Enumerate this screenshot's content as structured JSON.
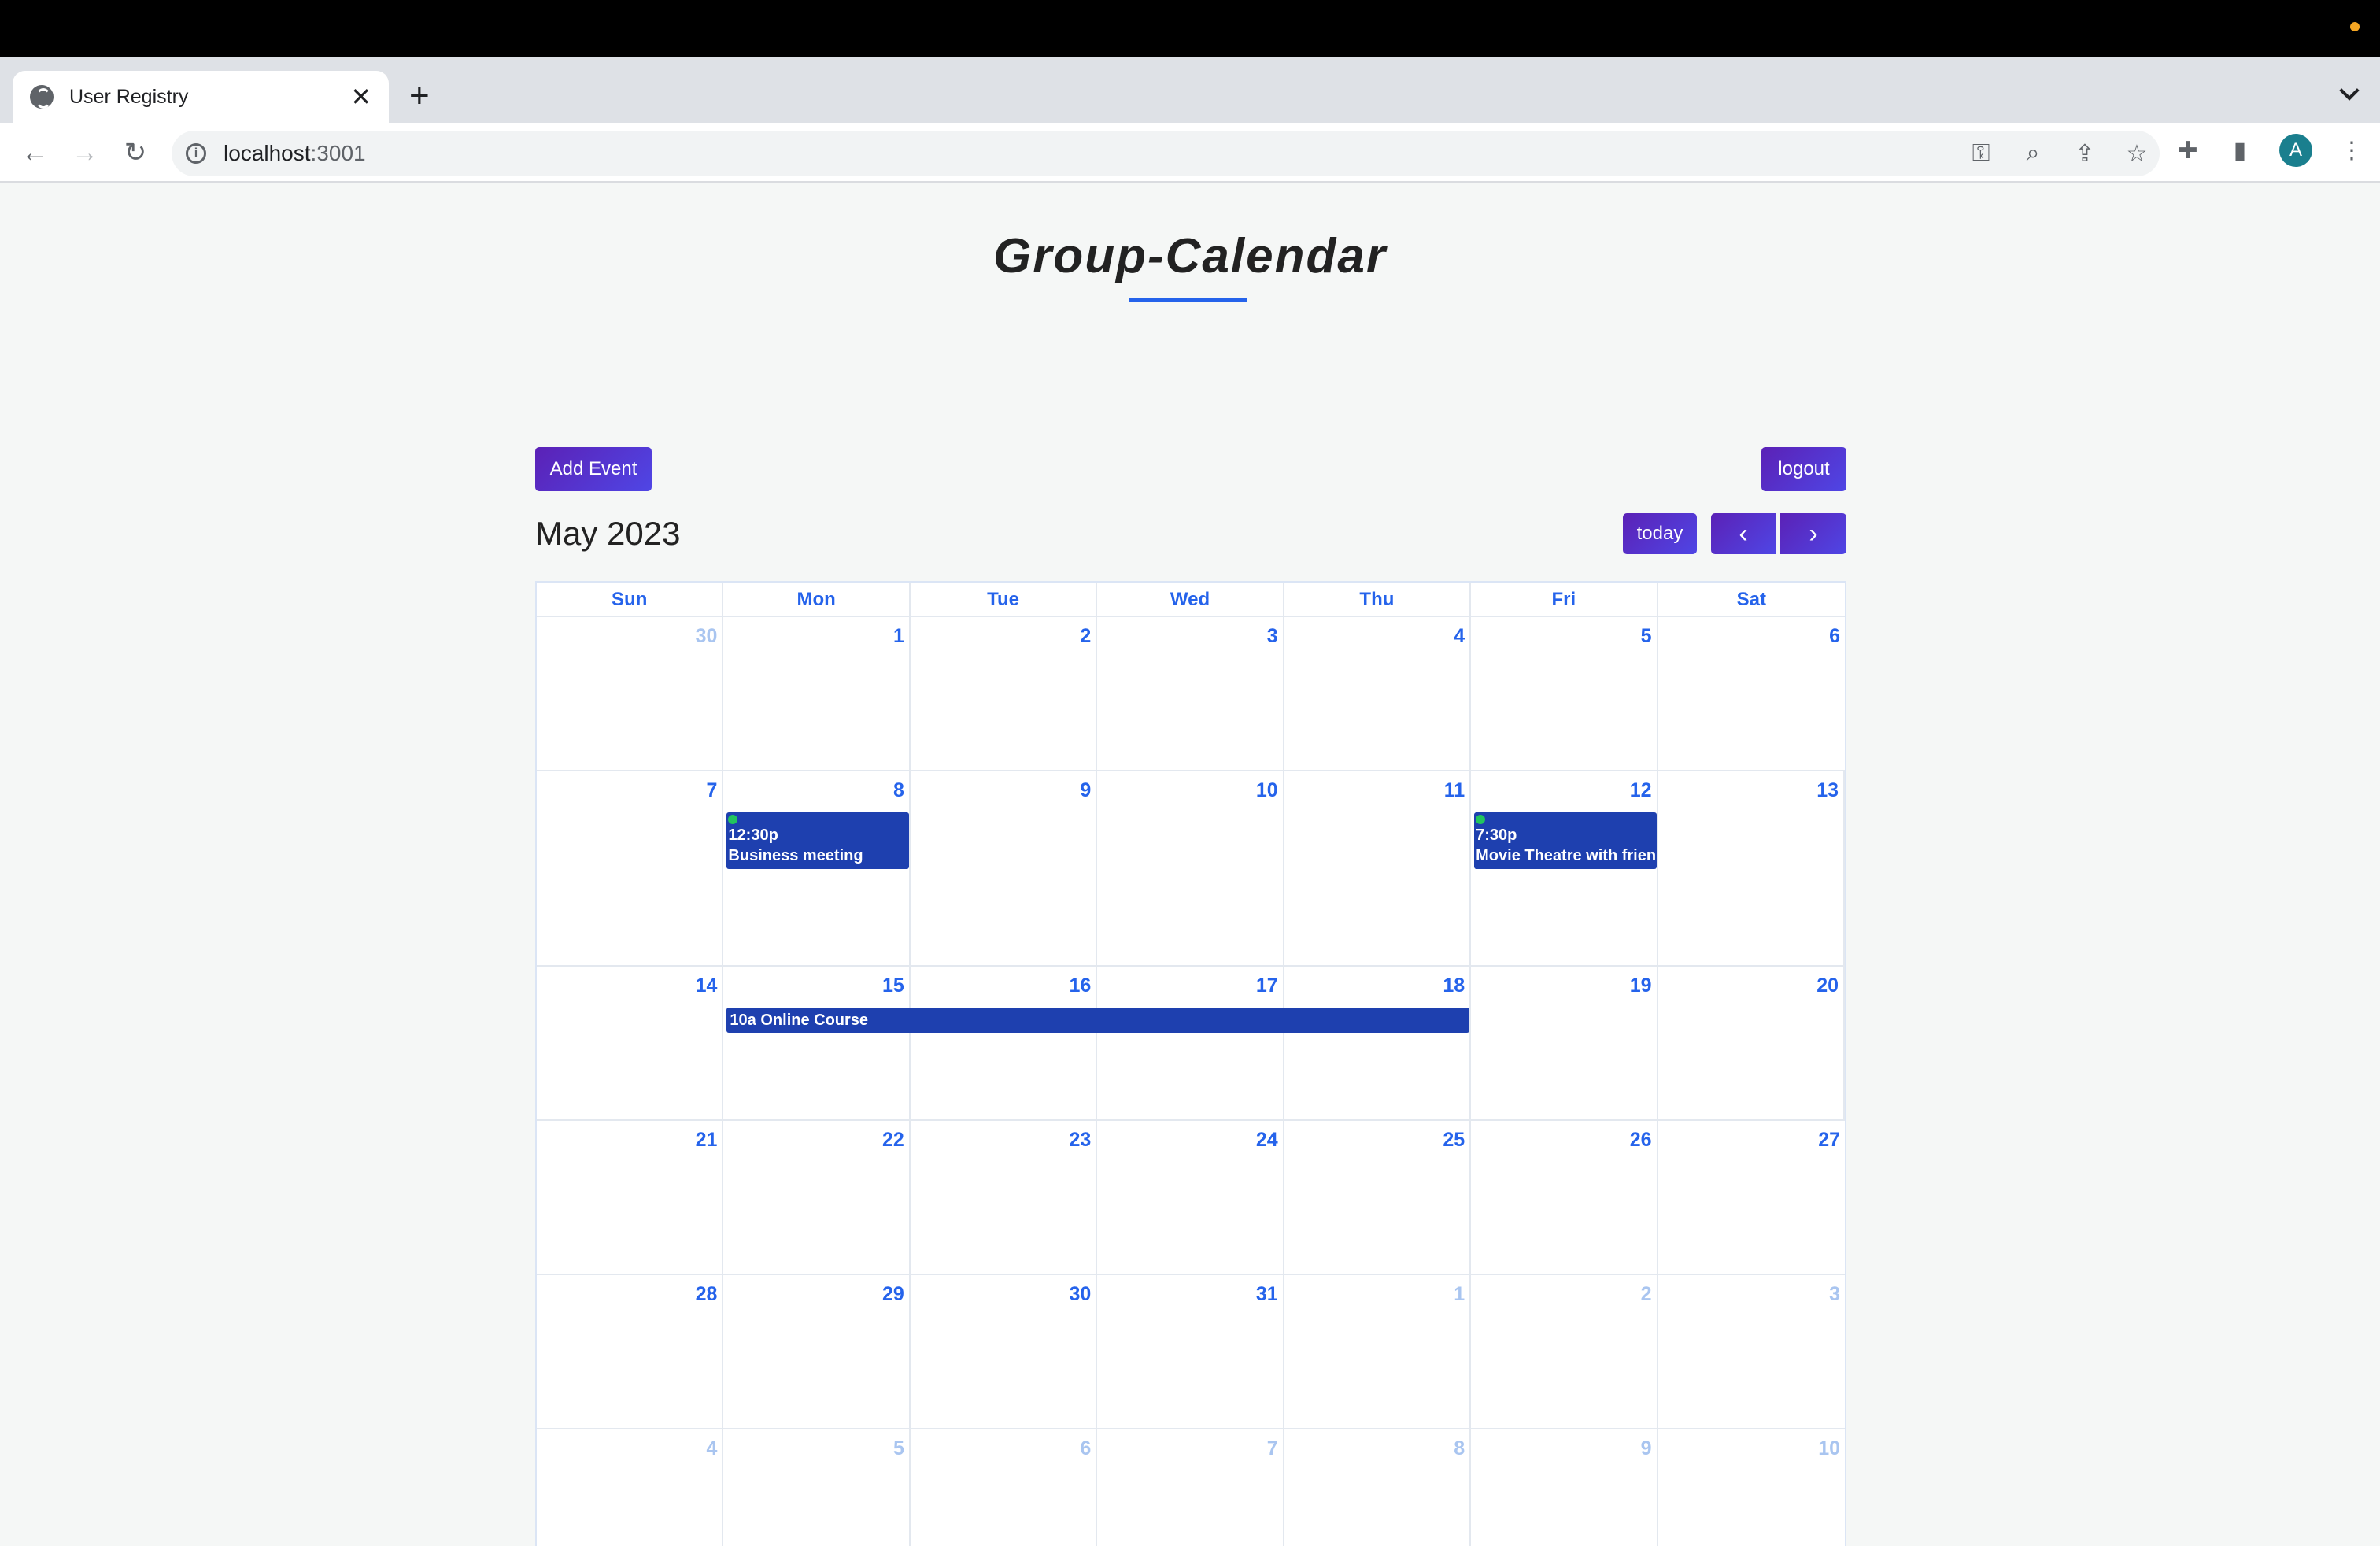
{
  "browser": {
    "tab_title": "User Registry",
    "new_tab": "+",
    "close": "✕",
    "url_host": "localhost",
    "url_port": ":3001",
    "profile_initial": "A"
  },
  "page": {
    "title": "Group-Calendar",
    "add_event_label": "Add Event",
    "logout_label": "logout",
    "today_label": "today",
    "prev_label": "‹",
    "next_label": "›",
    "month_label": "May 2023"
  },
  "calendar": {
    "days_of_week": [
      "Sun",
      "Mon",
      "Tue",
      "Wed",
      "Thu",
      "Fri",
      "Sat"
    ],
    "weeks": [
      [
        {
          "d": "30",
          "o": true
        },
        {
          "d": "1"
        },
        {
          "d": "2"
        },
        {
          "d": "3"
        },
        {
          "d": "4"
        },
        {
          "d": "5"
        },
        {
          "d": "6"
        }
      ],
      [
        {
          "d": "7"
        },
        {
          "d": "8"
        },
        {
          "d": "9"
        },
        {
          "d": "10"
        },
        {
          "d": "11"
        },
        {
          "d": "12"
        },
        {
          "d": "13"
        }
      ],
      [
        {
          "d": "14"
        },
        {
          "d": "15"
        },
        {
          "d": "16"
        },
        {
          "d": "17"
        },
        {
          "d": "18"
        },
        {
          "d": "19"
        },
        {
          "d": "20"
        }
      ],
      [
        {
          "d": "21"
        },
        {
          "d": "22"
        },
        {
          "d": "23"
        },
        {
          "d": "24"
        },
        {
          "d": "25"
        },
        {
          "d": "26"
        },
        {
          "d": "27"
        }
      ],
      [
        {
          "d": "28"
        },
        {
          "d": "29"
        },
        {
          "d": "30"
        },
        {
          "d": "31"
        },
        {
          "d": "1",
          "o": true
        },
        {
          "d": "2",
          "o": true
        },
        {
          "d": "3",
          "o": true
        }
      ],
      [
        {
          "d": "4",
          "o": true
        },
        {
          "d": "5",
          "o": true
        },
        {
          "d": "6",
          "o": true
        },
        {
          "d": "7",
          "o": true
        },
        {
          "d": "8",
          "o": true
        },
        {
          "d": "9",
          "o": true
        },
        {
          "d": "10",
          "o": true
        }
      ]
    ],
    "events": [
      {
        "week": 1,
        "day": 1,
        "span": 1,
        "time": "12:30p",
        "title": "Business meeting",
        "style": "block"
      },
      {
        "week": 1,
        "day": 5,
        "span": 1,
        "time": "7:30p",
        "title": "Movie Theatre with friends",
        "style": "block"
      },
      {
        "week": 2,
        "day": 1,
        "span": 4,
        "time": "10a",
        "title": "Online Course",
        "style": "bar"
      }
    ]
  },
  "colors": {
    "accent": "#2563eb",
    "button_start": "#5b21b6",
    "button_end": "#4f46e5",
    "event_bg": "#1e40af",
    "event_dot": "#22c55e"
  }
}
